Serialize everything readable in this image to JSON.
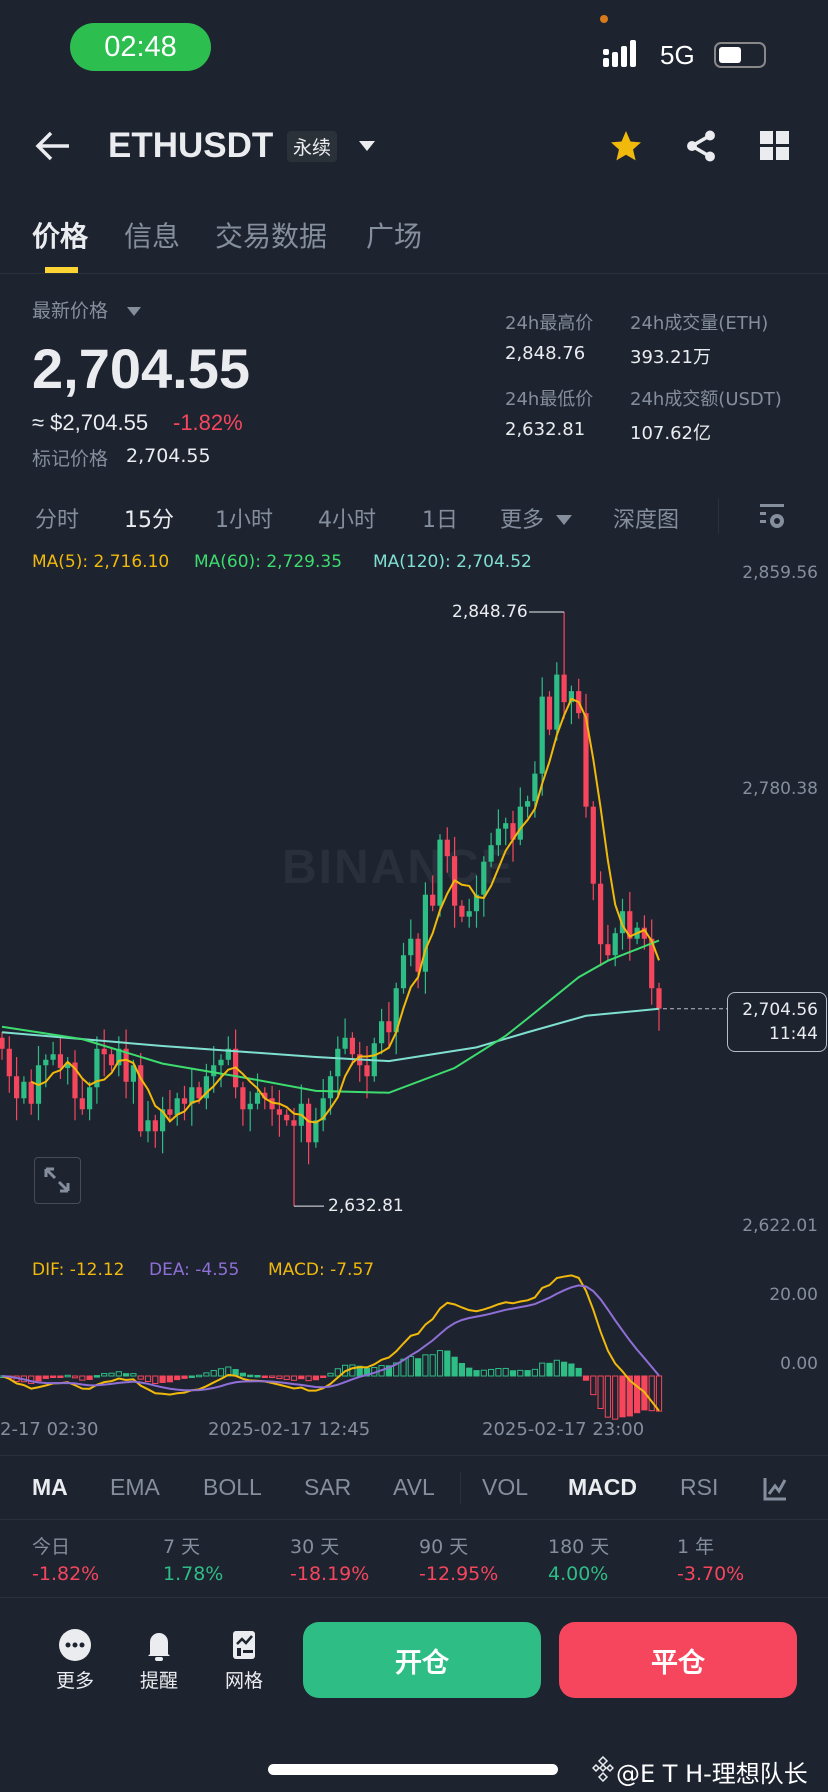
{
  "status": {
    "time": "02:48",
    "network": "5G"
  },
  "header": {
    "symbol": "ETHUSDT",
    "badge": "永续"
  },
  "tabs": [
    "价格",
    "信息",
    "交易数据",
    "广场"
  ],
  "price": {
    "label": "最新价格",
    "last": "2,704.55",
    "approx": "≈ $2,704.55",
    "change": "-1.82%",
    "mark_label": "标记价格",
    "mark": "2,704.55"
  },
  "stats": {
    "high_label": "24h最高价",
    "high": "2,848.76",
    "vol_label": "24h成交量(ETH)",
    "vol": "393.21万",
    "low_label": "24h最低价",
    "low": "2,632.81",
    "amt_label": "24h成交额(USDT)",
    "amt": "107.62亿"
  },
  "intervals": [
    "分时",
    "15分",
    "1小时",
    "4小时",
    "1日",
    "更多",
    "深度图"
  ],
  "chart_legend": {
    "ma5": "MA(5): 2,716.10",
    "ma60": "MA(60): 2,729.35",
    "ma120": "MA(120): 2,704.52"
  },
  "axis": {
    "top": "2,859.56",
    "mid": "2,780.38",
    "bottom": "2,622.01",
    "macd_top": "20.00",
    "macd_zero": "0.00"
  },
  "annotations": {
    "high": "2,848.76",
    "low": "2,632.81",
    "current": "2,704.56",
    "countdown": "11:44"
  },
  "watermark": "BINANCE",
  "macd_legend": {
    "dif": "DIF: -12.12",
    "dea": "DEA: -4.55",
    "macd": "MACD: -7.57"
  },
  "dates": [
    "2-17 02:30",
    "2025-02-17 12:45",
    "2025-02-17 23:00"
  ],
  "indicators": [
    "MA",
    "EMA",
    "BOLL",
    "SAR",
    "AVL",
    "VOL",
    "MACD",
    "RSI"
  ],
  "periods": [
    {
      "label": "今日",
      "value": "-1.82%"
    },
    {
      "label": "7 天",
      "value": "1.78%"
    },
    {
      "label": "30 天",
      "value": "-18.19%"
    },
    {
      "label": "90 天",
      "value": "-12.95%"
    },
    {
      "label": "180 天",
      "value": "4.00%"
    },
    {
      "label": "1 年",
      "value": "-3.70%"
    }
  ],
  "bottom": {
    "more": "更多",
    "alert": "提醒",
    "grid": "网格",
    "open": "开仓",
    "close": "平仓"
  },
  "credit": "@E T H-理想队长",
  "colors": {
    "up": "#2ebd85",
    "down": "#f6465d",
    "ma5": "#f0b90b",
    "ma60": "#3ddc6e",
    "ma120": "#7fe0d0",
    "dea": "#8e6fd6",
    "accent": "#fcd535"
  },
  "chart_data": {
    "type": "candlestick",
    "interval": "15m",
    "closes": [
      2690,
      2680,
      2672,
      2678,
      2670,
      2684,
      2686,
      2688,
      2683,
      2685,
      2672,
      2668,
      2676,
      2690,
      2688,
      2684,
      2690,
      2678,
      2684,
      2660,
      2664,
      2660,
      2668,
      2666,
      2672,
      2670,
      2676,
      2672,
      2680,
      2684,
      2686,
      2690,
      2676,
      2668,
      2670,
      2674,
      2672,
      2668,
      2666,
      2664,
      2662,
      2670,
      2656,
      2664,
      2672,
      2680,
      2690,
      2694,
      2688,
      2684,
      2680,
      2692,
      2700,
      2696,
      2712,
      2724,
      2730,
      2718,
      2746,
      2742,
      2766,
      2760,
      2742,
      2738,
      2740,
      2746,
      2758,
      2764,
      2770,
      2772,
      2766,
      2778,
      2780,
      2790,
      2818,
      2806,
      2826,
      2816,
      2820,
      2812,
      2778,
      2750,
      2728,
      2724,
      2732,
      2740,
      2730,
      2734,
      2730,
      2712,
      2704.56
    ],
    "first_open": 2694,
    "high": {
      "index": 77,
      "value": 2848.76
    },
    "low": {
      "index": 40,
      "value": 2632.81
    },
    "ma60": [
      [
        0,
        2698
      ],
      [
        11,
        2693.5
      ],
      [
        22,
        2684.6
      ],
      [
        33,
        2679.6
      ],
      [
        43,
        2674.7
      ],
      [
        53,
        2674
      ],
      [
        62,
        2683
      ],
      [
        69,
        2694.7
      ],
      [
        72,
        2701
      ],
      [
        79,
        2716
      ],
      [
        83,
        2722
      ],
      [
        90,
        2729.35
      ]
    ],
    "ma120": [
      [
        0,
        2696
      ],
      [
        22,
        2691
      ],
      [
        43,
        2687
      ],
      [
        53,
        2685.5
      ],
      [
        65,
        2690.5
      ],
      [
        72,
        2696
      ],
      [
        80,
        2702
      ],
      [
        90,
        2704.52
      ]
    ],
    "ylim": [
      2622.01,
      2859.56
    ]
  }
}
